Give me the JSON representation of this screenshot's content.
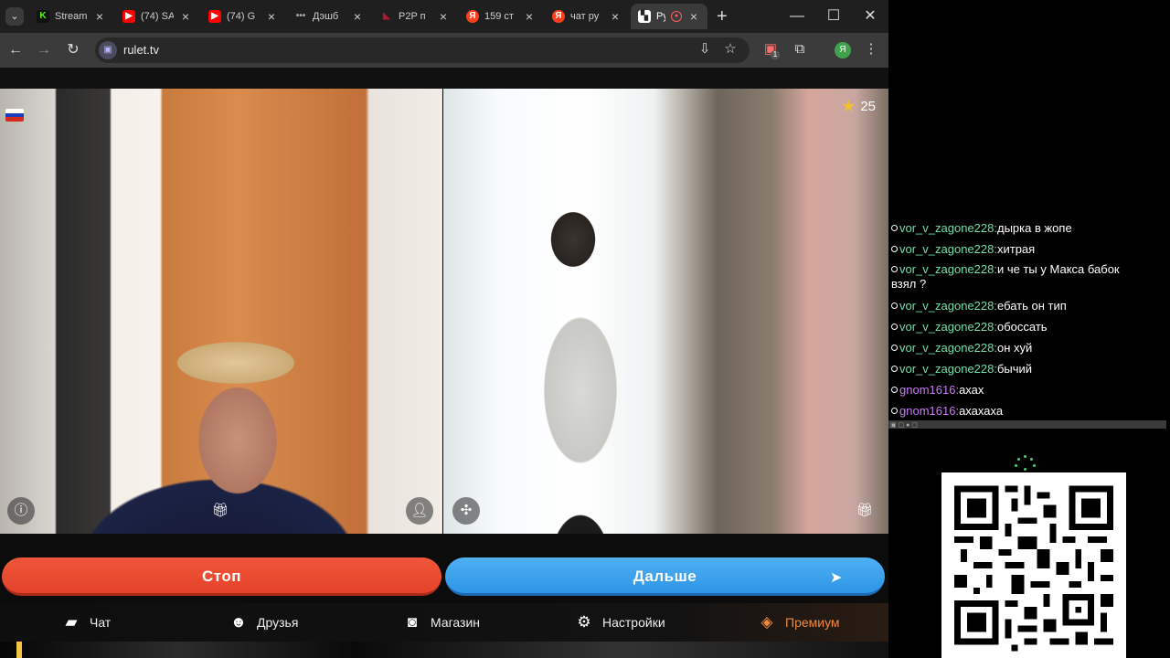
{
  "browser": {
    "tabs": [
      {
        "title": "Stream",
        "icon": "kick-icon",
        "color": "#53fc18",
        "active": false
      },
      {
        "title": "(74) SA",
        "icon": "youtube-icon",
        "color": "#ff0000",
        "active": false
      },
      {
        "title": "(74) G",
        "icon": "youtube-icon",
        "color": "#ff0000",
        "active": false
      },
      {
        "title": "Дэшб",
        "icon": "dashboard-icon",
        "color": "#888888",
        "active": false
      },
      {
        "title": "P2P п",
        "icon": "p2p-icon",
        "color": "#b0192e",
        "active": false
      },
      {
        "title": "159 ст",
        "icon": "yandex-icon",
        "color": "#fc3f1d",
        "active": false
      },
      {
        "title": "чат ру",
        "icon": "yandex-icon",
        "color": "#fc3f1d",
        "active": false
      },
      {
        "title": "Ру",
        "icon": "rulet-icon",
        "color": "#ffffff",
        "active": true
      }
    ],
    "url": "rulet.tv",
    "profile_letter": "Я",
    "extension_badge": "1"
  },
  "video": {
    "stars": "25"
  },
  "buttons": {
    "stop": "Стоп",
    "next": "Дальше"
  },
  "menu": {
    "chat": "Чат",
    "friends": "Друзья",
    "shop": "Магазин",
    "settings": "Настройки",
    "premium": "Премиум"
  },
  "chat": {
    "messages": [
      {
        "user": "vor_v_zagone228:",
        "text": "дырка в жопе"
      },
      {
        "user": "vor_v_zagone228:",
        "text": "хитрая"
      },
      {
        "user": "vor_v_zagone228:",
        "text": "и че ты у Макса бабок взял ?"
      },
      {
        "user": "vor_v_zagone228:",
        "text": "ебать он тип"
      },
      {
        "user": "vor_v_zagone228:",
        "text": "обоссать"
      },
      {
        "user": "vor_v_zagone228:",
        "text": "он хуй"
      },
      {
        "user": "vor_v_zagone228:",
        "text": "бычий"
      },
      {
        "user": "gnom1616:",
        "text": "ахах"
      },
      {
        "user": "gnom1616:",
        "text": "ахахаха"
      }
    ]
  },
  "colors": {
    "stop_button": "#e94a30",
    "next_button": "#3aa0ea",
    "chat_user_green": "#6fe0a8",
    "chat_user_pink": "#c97bf5",
    "premium": "#f08a3c"
  }
}
